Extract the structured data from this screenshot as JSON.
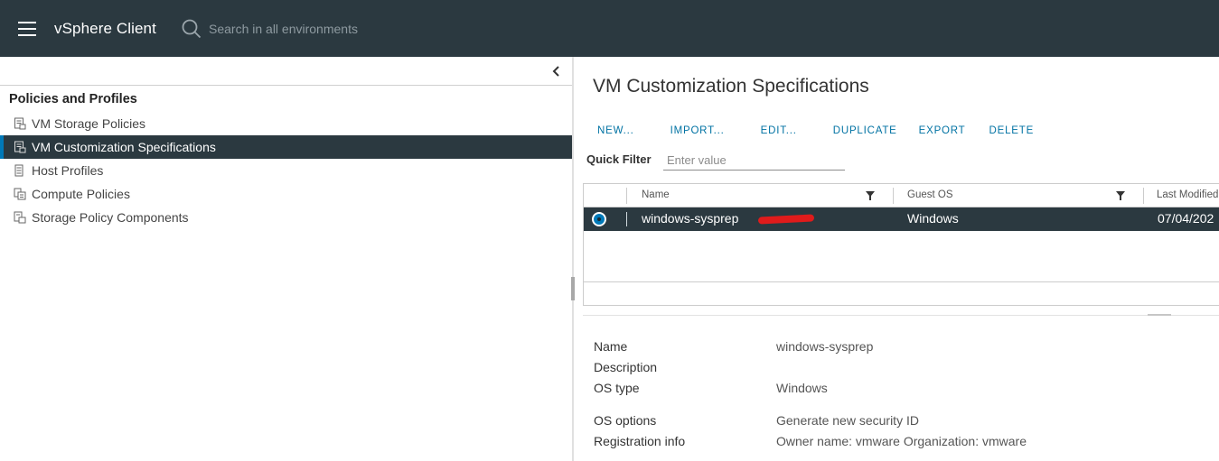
{
  "header": {
    "app_title": "vSphere Client",
    "search_placeholder": "Search in all environments"
  },
  "sidebar": {
    "section_title": "Policies and Profiles",
    "items": [
      {
        "label": "VM Storage Policies",
        "icon": "storage-policy-icon"
      },
      {
        "label": "VM Customization Specifications",
        "icon": "customization-spec-icon",
        "active": true
      },
      {
        "label": "Host Profiles",
        "icon": "host-profile-icon"
      },
      {
        "label": "Compute Policies",
        "icon": "compute-policy-icon"
      },
      {
        "label": "Storage Policy Components",
        "icon": "storage-component-icon"
      }
    ]
  },
  "main": {
    "title": "VM Customization Specifications",
    "toolbar": [
      "NEW...",
      "IMPORT...",
      "EDIT...",
      "DUPLICATE",
      "EXPORT",
      "DELETE"
    ],
    "quick_filter_label": "Quick Filter",
    "quick_filter_placeholder": "Enter value",
    "grid": {
      "columns": [
        "Name",
        "Guest OS",
        "Last Modified"
      ],
      "rows": [
        {
          "name": "windows-sysprep",
          "guest_os": "Windows",
          "last_modified": "07/04/202",
          "selected": true
        }
      ]
    },
    "details": [
      {
        "key": "Name",
        "value": "windows-sysprep"
      },
      {
        "key": "Description",
        "value": ""
      },
      {
        "key": "OS type",
        "value": "Windows"
      },
      {
        "key": "OS options",
        "value": "Generate new security ID"
      },
      {
        "key": "Registration info",
        "value": "Owner name: vmware Organization: vmware"
      }
    ]
  },
  "colors": {
    "header_bg": "#2b3940",
    "accent": "#0079b8",
    "link": "#0072a3",
    "redaction": "#e01b1b"
  }
}
